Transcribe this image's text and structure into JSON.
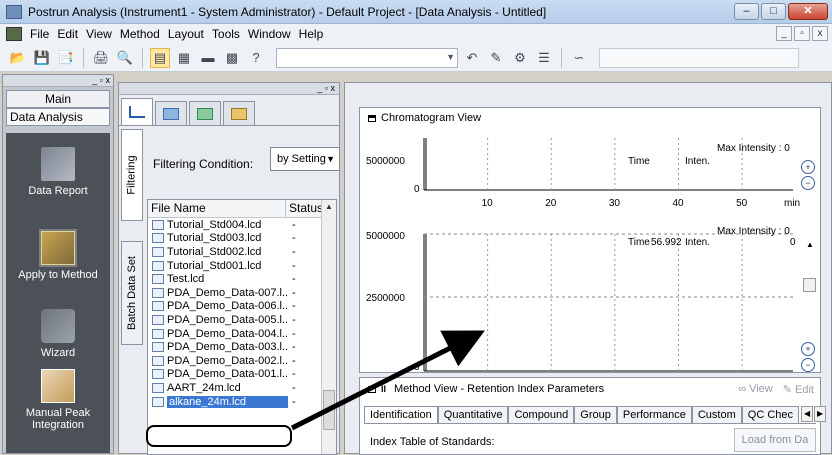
{
  "titlebar": {
    "title": "Postrun Analysis (Instrument1 - System Administrator) - Default Project - [Data Analysis - Untitled]",
    "min_glyph": "–",
    "max_glyph": "□",
    "close_glyph": "✕"
  },
  "menubar": {
    "items": [
      "File",
      "Edit",
      "View",
      "Method",
      "Layout",
      "Tools",
      "Window",
      "Help"
    ],
    "mdi": [
      "_",
      "▫",
      "x"
    ]
  },
  "toolbar": {
    "help_glyph": "?"
  },
  "main_panel": {
    "header_glyphs": "_ ▫ x",
    "tab_label": "Main",
    "subtab_label": "Data Analysis",
    "items": [
      {
        "label": "Data Report",
        "icon": "data-report-icon"
      },
      {
        "label": "Apply to Method",
        "icon": "apply-to-method-icon"
      },
      {
        "label": "Wizard",
        "icon": "wizard-icon"
      },
      {
        "label": "Manual Peak Integration",
        "icon": "manual-peak-integration-icon"
      }
    ]
  },
  "data_panel": {
    "header_glyphs": "_ ▫ x",
    "vtabs": [
      "Filtering",
      "Batch Data Set"
    ],
    "filter_label": "Filtering Condition:",
    "filter_value": "by Setting",
    "columns": {
      "name": "File Name",
      "status": "Status"
    },
    "files": [
      {
        "name": "Tutorial_Std004.lcd",
        "status": "-"
      },
      {
        "name": "Tutorial_Std003.lcd",
        "status": "-"
      },
      {
        "name": "Tutorial_Std002.lcd",
        "status": "-"
      },
      {
        "name": "Tutorial_Std001.lcd",
        "status": "-"
      },
      {
        "name": "Test.lcd",
        "status": "-"
      },
      {
        "name": "PDA_Demo_Data-007.l...",
        "status": "-"
      },
      {
        "name": "PDA_Demo_Data-006.l...",
        "status": "-"
      },
      {
        "name": "PDA_Demo_Data-005.l...",
        "status": "-"
      },
      {
        "name": "PDA_Demo_Data-004.l...",
        "status": "-"
      },
      {
        "name": "PDA_Demo_Data-003.l...",
        "status": "-"
      },
      {
        "name": "PDA_Demo_Data-002.l...",
        "status": "-"
      },
      {
        "name": "PDA_Demo_Data-001.l...",
        "status": "-"
      },
      {
        "name": "AART_24m.lcd",
        "status": "-"
      },
      {
        "name": "alkane_24m.lcd",
        "status": "-",
        "selected": true
      }
    ]
  },
  "chromatogram": {
    "title": "Chromatogram View",
    "plot1": {
      "ymax": "5000000",
      "ymin": "0",
      "max_intensity": "Max Intensity :    0",
      "time_label": "Time",
      "inten_label": "Inten."
    },
    "plot2": {
      "ymax": "5000000",
      "ymid": "2500000",
      "ymin": "0",
      "max_intensity": "Max Intensity :    0",
      "time_label": "Time",
      "time_value": "56.992",
      "inten_label": "Inten.",
      "inten_value": "0"
    },
    "x_ticks": [
      "10",
      "20",
      "30",
      "40",
      "50"
    ],
    "x_unit": "min"
  },
  "method_view": {
    "title": "Method View - Retention Index Parameters",
    "view_label": "View",
    "edit_label": "Edit",
    "tabs": [
      "Identification",
      "Quantitative",
      "Compound",
      "Group",
      "Performance",
      "Custom",
      "QC Chec"
    ],
    "index_label": "Index Table of Standards:",
    "load_label": "Load from Da"
  },
  "colors": {
    "selection": "#3a78d4",
    "dark_panel": "#4c5057",
    "plot_trace": "#000000"
  }
}
